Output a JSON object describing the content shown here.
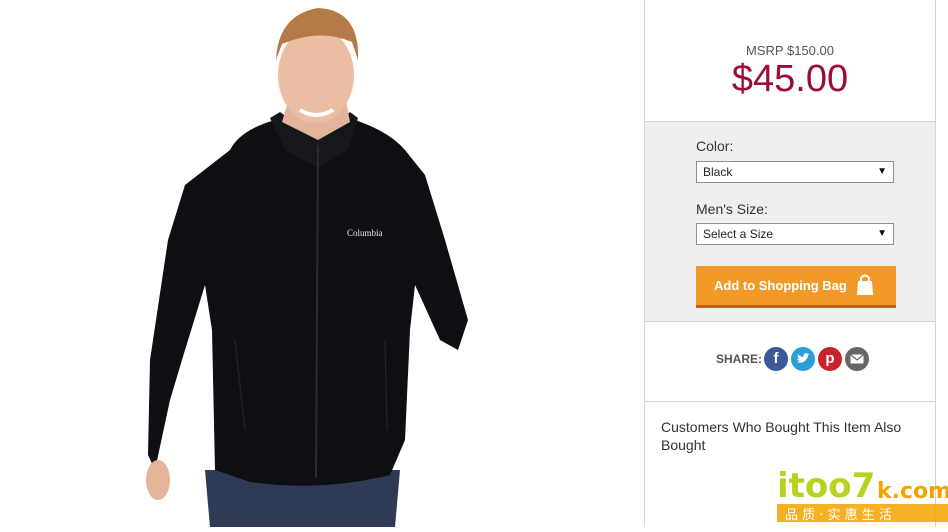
{
  "product": {
    "image_alt": "Men's black Columbia fleece jacket",
    "brand_logo_text": "Columbia"
  },
  "pricing": {
    "msrp": "MSRP $150.00",
    "price": "$45.00"
  },
  "options": {
    "color_label": "Color:",
    "color_value": "Black",
    "size_label": "Men's Size:",
    "size_value": "Select a Size",
    "add_button": "Add to Shopping Bag"
  },
  "share": {
    "label": "SHARE:",
    "icons": [
      "facebook-icon",
      "twitter-icon",
      "pinterest-icon",
      "email-icon"
    ]
  },
  "also_bought": {
    "title": "Customers Who Bought This Item Also Bought"
  },
  "watermark": {
    "logo_text": "itoo7k.com",
    "tagline": "品 质 · 实 惠 生 活"
  },
  "colors": {
    "price": "#9c0c3b",
    "button": "#f19a28",
    "button_border": "#d9541e",
    "facebook": "#3b5998",
    "twitter": "#2a9fd6",
    "pinterest": "#c8232c",
    "email": "#666666"
  }
}
